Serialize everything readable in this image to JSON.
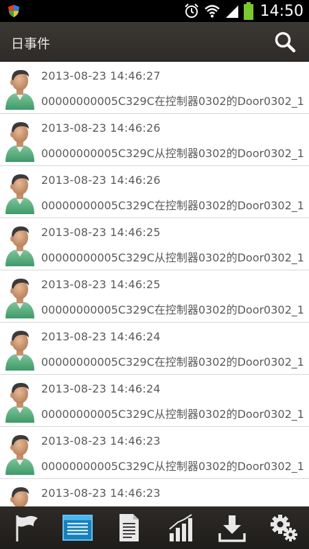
{
  "status_bar": {
    "time": "14:50",
    "icons": [
      "shield-icon",
      "alarm-icon",
      "wifi-icon",
      "signal-icon",
      "battery-icon"
    ]
  },
  "action_bar": {
    "title": "日事件",
    "search_icon": "search-icon"
  },
  "events": [
    {
      "time": "2013-08-23 14:46:27",
      "desc": "00000000005C329C在控制器0302的Door0302_1"
    },
    {
      "time": "2013-08-23 14:46:26",
      "desc": "00000000005C329C从控制器0302的Door0302_1"
    },
    {
      "time": "2013-08-23 14:46:26",
      "desc": "00000000005C329C在控制器0302的Door0302_1"
    },
    {
      "time": "2013-08-23 14:46:25",
      "desc": "00000000005C329C从控制器0302的Door0302_1"
    },
    {
      "time": "2013-08-23 14:46:25",
      "desc": "00000000005C329C在控制器0302的Door0302_1"
    },
    {
      "time": "2013-08-23 14:46:24",
      "desc": "00000000005C329C在控制器0302的Door0302_1"
    },
    {
      "time": "2013-08-23 14:46:24",
      "desc": "00000000005C329C从控制器0302的Door0302_1"
    },
    {
      "time": "2013-08-23 14:46:23",
      "desc": "00000000005C329C从控制器0302的Door0302_1"
    },
    {
      "time": "2013-08-23 14:46:23",
      "desc": ""
    }
  ],
  "bottom_tabs": [
    {
      "icon": "flag-icon",
      "selected": false
    },
    {
      "icon": "list-window-icon",
      "selected": true
    },
    {
      "icon": "document-icon",
      "selected": false
    },
    {
      "icon": "bar-chart-icon",
      "selected": false
    },
    {
      "icon": "download-icon",
      "selected": false
    },
    {
      "icon": "settings-gears-icon",
      "selected": false
    }
  ],
  "colors": {
    "action_bar": "#34312e",
    "bottom_bar": "#262422",
    "accent_selected": "#2a9fd8",
    "text": "#5a5a5a"
  }
}
